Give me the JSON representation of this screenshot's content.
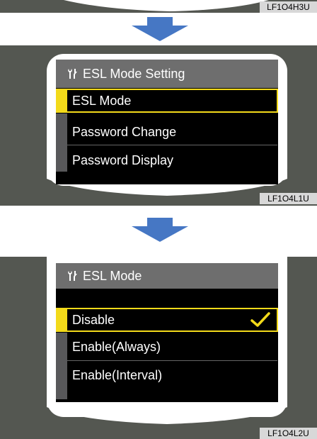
{
  "panels": [
    {
      "code": "LF1O4H3U"
    },
    {
      "code": "LF1O4L1U",
      "title": "ESL Mode Setting",
      "items": [
        "ESL Mode",
        "Password Change",
        "Password Display"
      ]
    },
    {
      "code": "LF1O4L2U",
      "title": "ESL Mode",
      "items": [
        "Disable",
        "Enable(Always)",
        "Enable(Interval)"
      ]
    }
  ],
  "icons": {
    "title": "wrench-icon",
    "arrow": "arrow-down-icon",
    "check": "checkmark-icon"
  },
  "colors": {
    "background": "#545751",
    "highlight": "#f3da1a",
    "arrow": "#4677c4",
    "code_tag": "#d8d8d8"
  }
}
